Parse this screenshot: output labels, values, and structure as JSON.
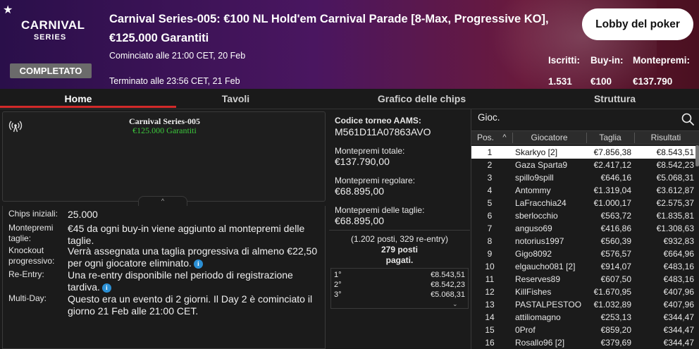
{
  "header": {
    "logo_line1": "CARNIVAL",
    "logo_line2": "SERIES",
    "status_badge": "COMPLETATO",
    "title": "Carnival Series-005: €100 NL Hold'em Carnival Parade [8-Max, Progressive KO], €125.000 Garantiti",
    "started": "Cominciato alle 21:00 CET, 20 Feb",
    "ended": "Terminato alle 23:56 CET, 21 Feb",
    "lobby_button": "Lobby del poker",
    "stats": {
      "entrants_label": "Iscritti:",
      "entrants_value": "1.531",
      "buyin_label": "Buy-in:",
      "buyin_value": "€100",
      "prizepool_label": "Montepremi:",
      "prizepool_value": "€137.790"
    }
  },
  "tabs": [
    "Home",
    "Tavoli",
    "Grafico delle chips",
    "Struttura"
  ],
  "summary": {
    "name": "Carnival Series-005",
    "guarantee": "€125.000 Garantiti",
    "collapse_glyph": "^"
  },
  "details": [
    {
      "label": "Chips iniziali:",
      "value": "25.000"
    },
    {
      "label": "Montepremi taglie:",
      "value": "€45 da ogni buy-in viene aggiunto al montepremi delle taglie."
    },
    {
      "label": "Knockout progressivo:",
      "value": "Verrà assegnata una taglia progressiva di almeno €22,50 per ogni giocatore eliminato."
    },
    {
      "label": "Re-Entry:",
      "value": "Una re-entry disponibile nel periodo di registrazione tardiva."
    },
    {
      "label": "Multi-Day:",
      "value": "Questo era un evento di 2 giorni. Il Day 2 è cominciato il giorno 21 Feb alle 21:00 CET."
    }
  ],
  "prizes": {
    "code_label": "Codice torneo AAMS:",
    "code_value": "M561D11A07863AVO",
    "total_label": "Montepremi totale:",
    "total_value": "€137.790,00",
    "regular_label": "Montepremi regolare:",
    "regular_value": "€68.895,00",
    "bounty_label": "Montepremi delle taglie:",
    "bounty_value": "€68.895,00",
    "places_line1": "(1.202 posti, 329 re-entry)",
    "places_line2": "279 posti",
    "places_line3": "pagati.",
    "payouts": [
      {
        "place": "1°",
        "amount": "€8.543,51"
      },
      {
        "place": "2°",
        "amount": "€8.542,23"
      },
      {
        "place": "3°",
        "amount": "€5.068,31"
      }
    ]
  },
  "players": {
    "search_label": "Gioc.",
    "columns": [
      "Pos.",
      "Giocatore",
      "Taglia",
      "Risultati"
    ],
    "sort_glyph": "^",
    "rows": [
      {
        "pos": "1",
        "name": "Skarkyo [2]",
        "bounty": "€7.856,38",
        "result": "€8.543,51"
      },
      {
        "pos": "2",
        "name": "Gaza Sparta9",
        "bounty": "€2.417,12",
        "result": "€8.542,23"
      },
      {
        "pos": "3",
        "name": "spillo9spill",
        "bounty": "€646,16",
        "result": "€5.068,31"
      },
      {
        "pos": "4",
        "name": "Antommy",
        "bounty": "€1.319,04",
        "result": "€3.612,87"
      },
      {
        "pos": "5",
        "name": "LaFracchia24",
        "bounty": "€1.000,17",
        "result": "€2.575,37"
      },
      {
        "pos": "6",
        "name": "sberlocchio",
        "bounty": "€563,72",
        "result": "€1.835,81"
      },
      {
        "pos": "7",
        "name": "anguso69",
        "bounty": "€416,86",
        "result": "€1.308,63"
      },
      {
        "pos": "8",
        "name": "notorius1997",
        "bounty": "€560,39",
        "result": "€932,83"
      },
      {
        "pos": "9",
        "name": "Gigo8092",
        "bounty": "€576,57",
        "result": "€664,96"
      },
      {
        "pos": "10",
        "name": "elgaucho081 [2]",
        "bounty": "€914,07",
        "result": "€483,16"
      },
      {
        "pos": "11",
        "name": "Reserves89",
        "bounty": "€607,50",
        "result": "€483,16"
      },
      {
        "pos": "12",
        "name": "KillFishes",
        "bounty": "€1.670,95",
        "result": "€407,96"
      },
      {
        "pos": "13",
        "name": "PASTALPESTOO",
        "bounty": "€1.032,89",
        "result": "€407,96"
      },
      {
        "pos": "14",
        "name": "attiliomagno",
        "bounty": "€253,13",
        "result": "€344,47"
      },
      {
        "pos": "15",
        "name": "0Prof",
        "bounty": "€859,20",
        "result": "€344,47"
      },
      {
        "pos": "16",
        "name": "Rosallo96 [2]",
        "bounty": "€379,69",
        "result": "€344,47"
      }
    ]
  },
  "colors": {
    "accent_red": "#d32a2a",
    "guarantee_green": "#3cc83c",
    "info_blue": "#2b8fd4"
  }
}
